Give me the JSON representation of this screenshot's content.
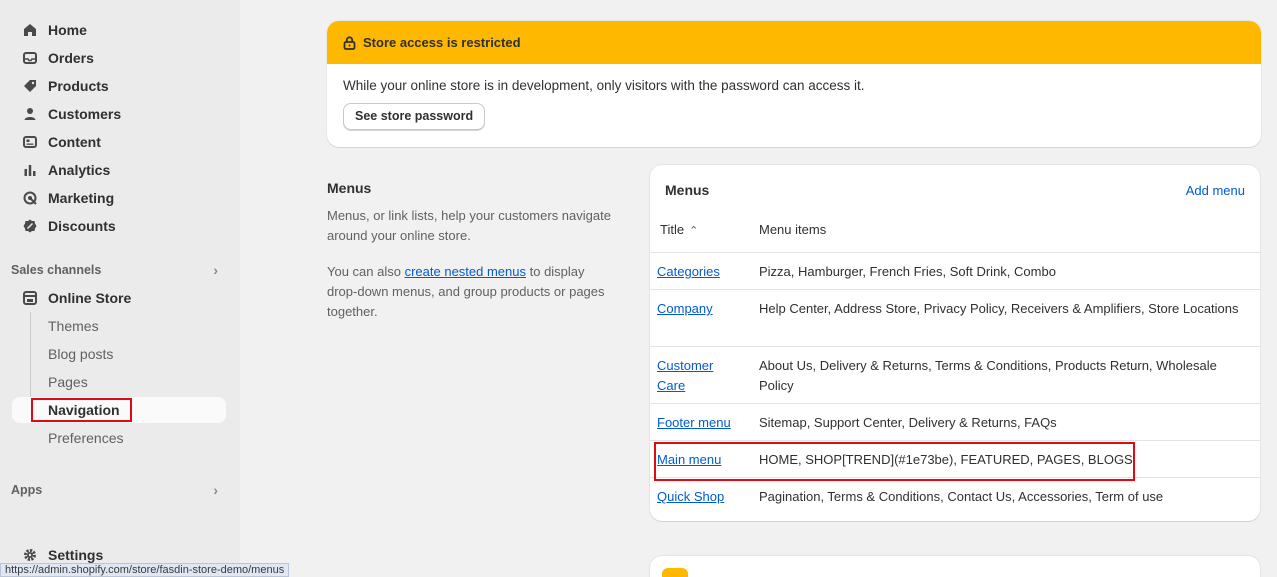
{
  "sidebar": {
    "items": [
      {
        "label": "Home",
        "icon": "home-icon"
      },
      {
        "label": "Orders",
        "icon": "orders-icon"
      },
      {
        "label": "Products",
        "icon": "tag-icon"
      },
      {
        "label": "Customers",
        "icon": "person-icon"
      },
      {
        "label": "Content",
        "icon": "content-icon"
      },
      {
        "label": "Analytics",
        "icon": "bar-chart-icon"
      },
      {
        "label": "Marketing",
        "icon": "target-icon"
      },
      {
        "label": "Discounts",
        "icon": "discount-icon"
      }
    ],
    "sales_channels_label": "Sales channels",
    "online_store_label": "Online Store",
    "online_store_subitems": [
      "Themes",
      "Blog posts",
      "Pages",
      "Navigation",
      "Preferences"
    ],
    "active_subitem": "Navigation",
    "apps_label": "Apps",
    "settings_label": "Settings",
    "status_url": "https://admin.shopify.com/store/fasdin-store-demo/menus"
  },
  "banner": {
    "title": "Store access is restricted",
    "message": "While your online store is in development, only visitors with the password can access it.",
    "button_label": "See store password",
    "color": "#ffb800"
  },
  "menus_info": {
    "heading": "Menus",
    "paragraph1": "Menus, or link lists, help your customers navigate around your online store.",
    "paragraph2_before": "You can also ",
    "paragraph2_link": "create nested menus",
    "paragraph2_after": " to display drop-down menus, and group products or pages together."
  },
  "menus_card": {
    "title": "Menus",
    "add_label": "Add menu",
    "col_title": "Title",
    "col_items": "Menu items",
    "rows": [
      {
        "title": "Categories",
        "items": "Pizza, Hamburger, French Fries, Soft Drink, Combo"
      },
      {
        "title": "Company",
        "items": "Help Center, Address Store, Privacy Policy, Receivers & Amplifiers, Store Locations"
      },
      {
        "title": "Customer Care",
        "items": "About Us, Delivery & Returns, Terms & Conditions, Products Return, Wholesale Policy"
      },
      {
        "title": "Footer menu",
        "items": "Sitemap, Support Center, Delivery & Returns, FAQs"
      },
      {
        "title": "Main menu",
        "items": "HOME, SHOP[TREND](#1e73be), FEATURED, PAGES, BLOGS"
      },
      {
        "title": "Quick Shop",
        "items": "Pagination, Terms & Conditions, Contact Us, Accessories, Term of use"
      }
    ]
  },
  "highlight_color": "#e00a17"
}
